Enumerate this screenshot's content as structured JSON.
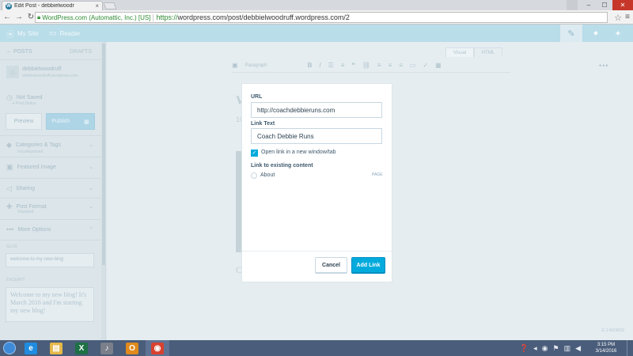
{
  "browser": {
    "tab_title": "Edit Post - debbielwoodr",
    "tab_close": "×",
    "win_minimize": "–",
    "win_maximize": "☐",
    "win_close": "✕",
    "ev_cert": "WordPress.com (Automattic, Inc.) [US]",
    "url_scheme": "https://",
    "url_rest": "wordpress.com/post/debbielwoodruff.wordpress.com/2",
    "back_glyph": "←",
    "forward_glyph": "→",
    "reload_glyph": "↻",
    "star_glyph": "☆",
    "menu_glyph": "≡"
  },
  "masterbar": {
    "my_site": "My Site",
    "reader": "Reader",
    "write_glyph": "✎",
    "avatar_glyph": "●",
    "notif_glyph": "✦"
  },
  "sidebar": {
    "back_label": "← POSTS",
    "drafts_label": "DRAFTS",
    "site_name": "debbielwoodruff",
    "site_url": "debbielwoodruff.wordpress.com",
    "status_label": "Not Saved",
    "status_sub": "▸ Post Status",
    "preview": "Preview",
    "publish": "Publish",
    "items": [
      {
        "icon": "◆",
        "label": "Categories & Tags",
        "sub": "Uncategorized"
      },
      {
        "icon": "▣",
        "label": "Featured Image",
        "sub": ""
      },
      {
        "icon": "◁",
        "label": "Sharing",
        "sub": ""
      },
      {
        "icon": "✚",
        "label": "Post Format",
        "sub": "Standard"
      },
      {
        "icon": "•••",
        "label": "More Options",
        "sub": ""
      }
    ],
    "slug_label": "SLUG",
    "slug_value": "welcome-to-my-new-blog",
    "excerpt_label": "EXCERPT",
    "excerpt_value": "Welcome to my new blog! It's March 2016 and I'm starting my new blog!"
  },
  "editor": {
    "tab_visual": "Visual",
    "tab_html": "HTML",
    "paragraph": "Paragraph",
    "title_stub": "W",
    "content_stub": "10",
    "c_stub": "C",
    "more_glyph": "•••",
    "footer": "☰ 3 WORDS"
  },
  "dialog": {
    "url_label": "URL",
    "url_value": "http://coachdebbieruns.com",
    "text_label": "Link Text",
    "text_value": "Coach Debbie Runs",
    "new_window_label": "Open link in a new window/tab",
    "check_glyph": "✓",
    "existing_label": "Link to existing content",
    "existing_item": "About",
    "existing_type": "PAGE",
    "cancel": "Cancel",
    "add_link": "Add Link"
  },
  "taskbar": {
    "apps": [
      {
        "name": "internet-explorer-icon",
        "glyph": "e",
        "color": "#1f8ce0"
      },
      {
        "name": "file-explorer-icon",
        "glyph": "▤",
        "color": "#e6b84a"
      },
      {
        "name": "excel-icon",
        "glyph": "X",
        "color": "#1e7145"
      },
      {
        "name": "itunes-icon",
        "glyph": "♪",
        "color": "#7a7f8a"
      },
      {
        "name": "outlook-icon",
        "glyph": "O",
        "color": "#e08a1e"
      },
      {
        "name": "chrome-icon",
        "glyph": "◉",
        "color": "#d8412f"
      }
    ],
    "time": "3:15 PM",
    "date": "3/14/2016"
  }
}
